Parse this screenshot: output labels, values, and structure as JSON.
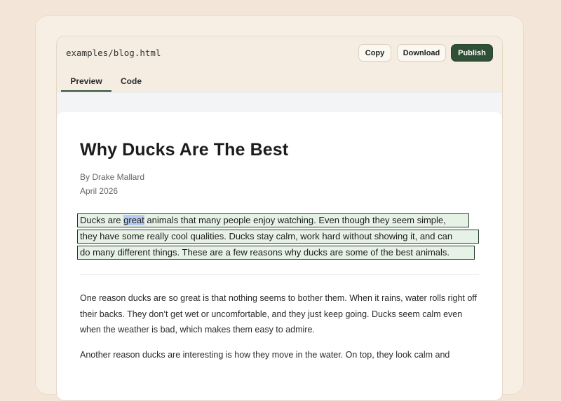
{
  "window": {
    "filename": "examples/blog.html",
    "buttons": {
      "copy": "Copy",
      "download": "Download",
      "publish": "Publish"
    },
    "tabs": [
      {
        "label": "Preview",
        "active": true
      },
      {
        "label": "Code",
        "active": false
      }
    ]
  },
  "article": {
    "title": "Why Ducks Are The Best",
    "byline": "By Drake Mallard",
    "date": "April 2026",
    "intro_lines": [
      {
        "pre": "Ducks are ",
        "sel": "great",
        "post": " animals that many people enjoy watching. Even though they seem simple,"
      },
      {
        "text": "they have some really cool qualities. Ducks stay calm, work hard without showing it, and can"
      },
      {
        "text": "do many different things. These are a few reasons why ducks are some of the best animals."
      }
    ],
    "paragraphs": [
      "One reason ducks are so great is that nothing seems to bother them. When it rains, water rolls right off their backs. They don’t get wet or uncomfortable, and they just keep going. Ducks seem calm even when the weather is bad, which makes them easy to admire.",
      "Another reason ducks are interesting is how they move in the water. On top, they look calm and"
    ]
  },
  "colors": {
    "background": "#f3e6d8",
    "publish_button": "#2f4f36",
    "highlight_border": "#233a2a",
    "highlight_fill": "#e7f2e6",
    "word_selection": "#b9ccf1"
  }
}
